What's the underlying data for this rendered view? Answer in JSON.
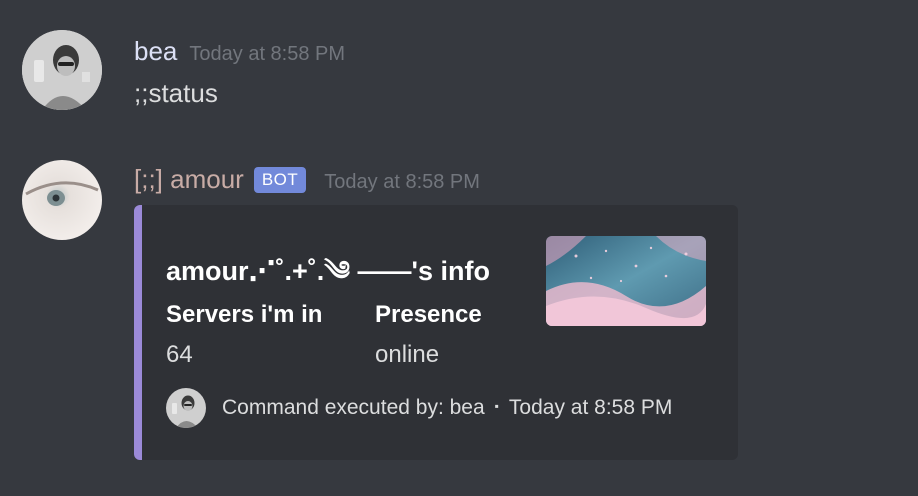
{
  "messages": [
    {
      "username": "bea",
      "username_color": "#dce0f5",
      "timestamp": "Today at 8:58 PM",
      "content": ";;status"
    },
    {
      "username": "[;;] amour",
      "username_color": "#c8aca6",
      "bot_tag": "BOT",
      "timestamp": "Today at 8:58 PM"
    }
  ],
  "embed": {
    "accent_color": "#9b8ad8",
    "title": "amour⋰˚.+˚.༄ ——'s info",
    "fields": [
      {
        "name": "Servers i'm in",
        "value": "64"
      },
      {
        "name": "Presence",
        "value": "online"
      }
    ],
    "footer": {
      "text": "Command executed by: bea",
      "separator": "▪",
      "timestamp": "Today at 8:58 PM"
    }
  }
}
